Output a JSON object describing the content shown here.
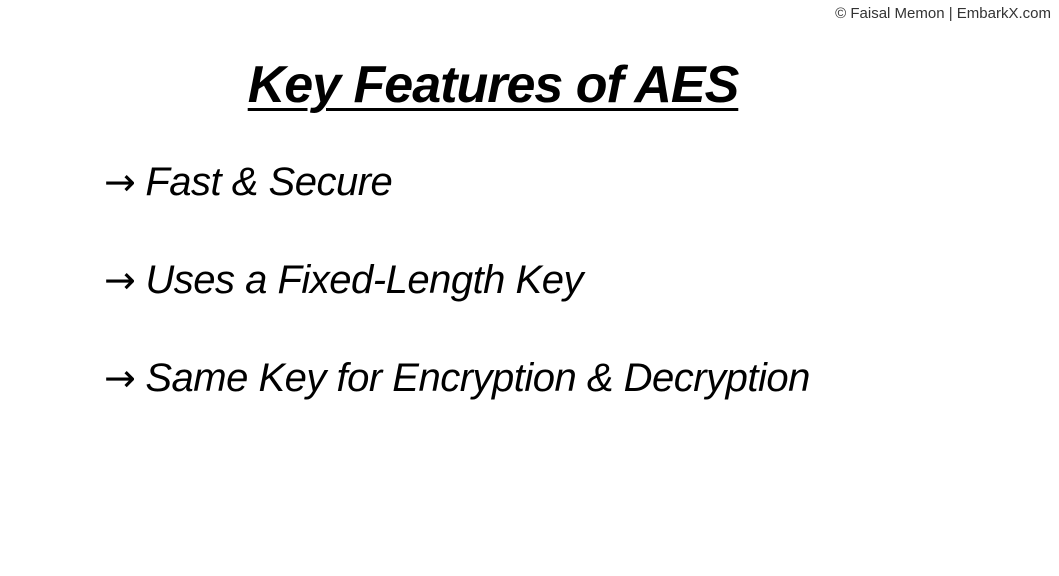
{
  "copyright": "© Faisal Memon | EmbarkX.com",
  "title": "Key Features of AES",
  "features": [
    {
      "arrow": "→",
      "text": "Fast & Secure"
    },
    {
      "arrow": "→",
      "text": "Uses a Fixed-Length Key"
    },
    {
      "arrow": "→",
      "text": "Same Key for Encryption & Decryption"
    }
  ]
}
